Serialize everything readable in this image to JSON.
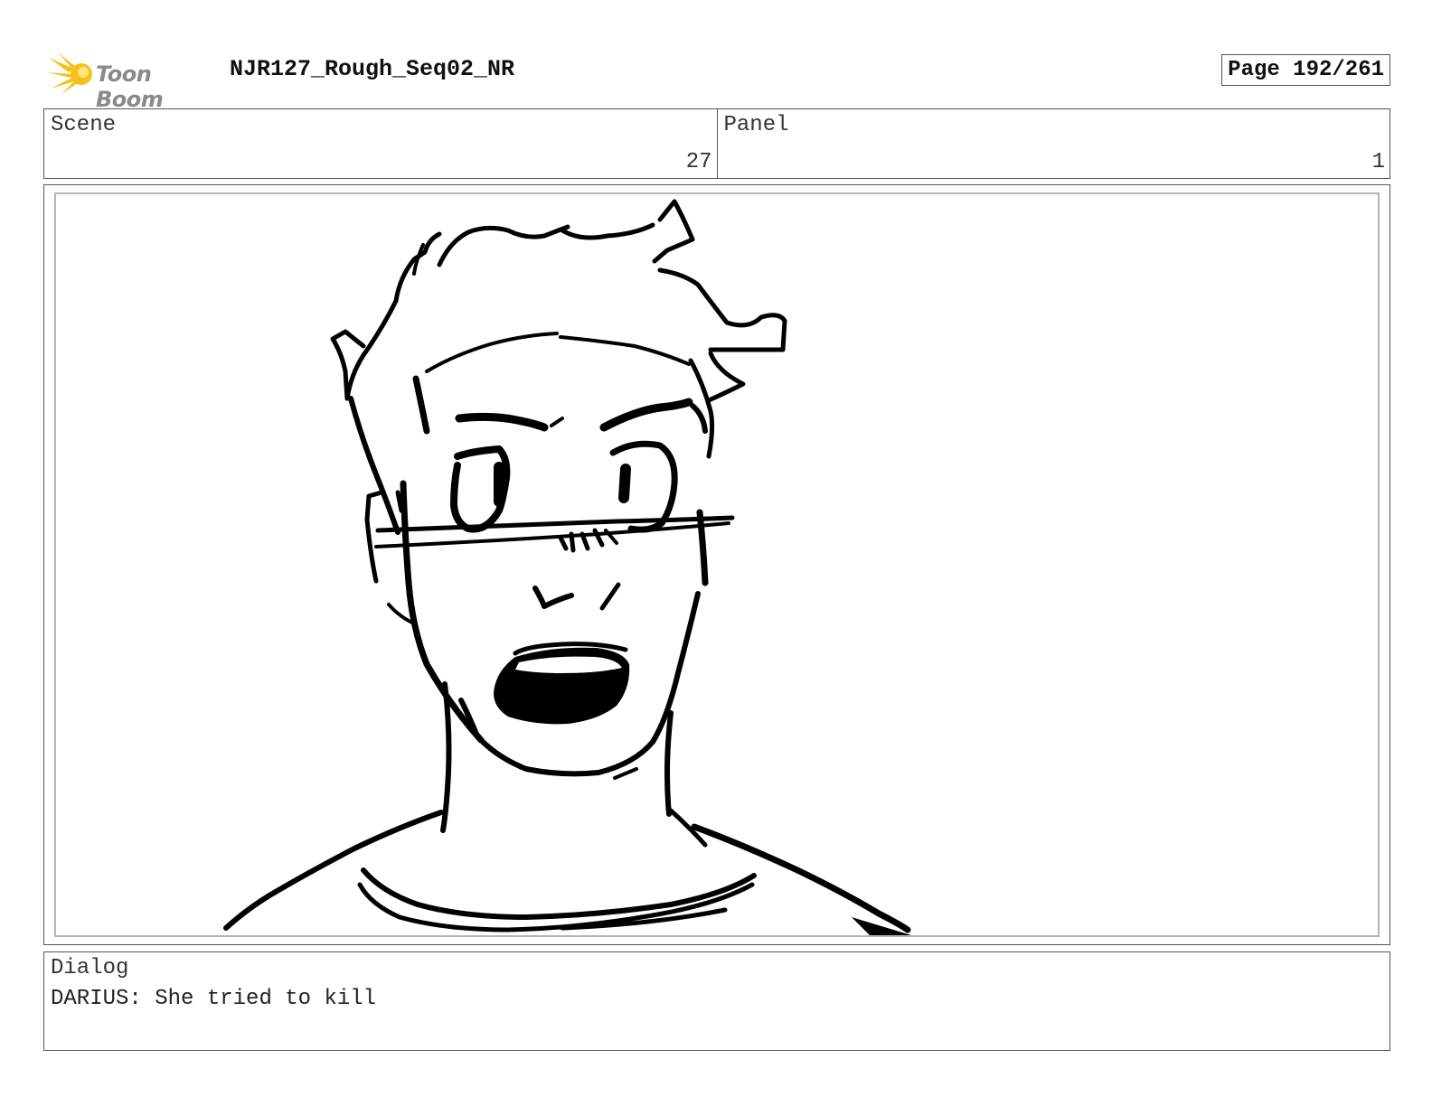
{
  "header": {
    "logo_text": "Toon Boom",
    "logo_icon": "toon-boom-star-icon",
    "title": "NJR127_Rough_Seq02_NR",
    "page": "Page 192/261"
  },
  "info": {
    "scene_label": "Scene",
    "scene_value": "27",
    "panel_label": "Panel",
    "panel_value": "1"
  },
  "dialog": {
    "label": "Dialog",
    "text": "DARIUS: She tried to kill"
  },
  "colors": {
    "logo_star": "#f6c21a",
    "logo_text": "#8a8a8a",
    "frame_border": "#555555",
    "panel_inner_border": "#b5b5b5",
    "ink": "#000000"
  }
}
